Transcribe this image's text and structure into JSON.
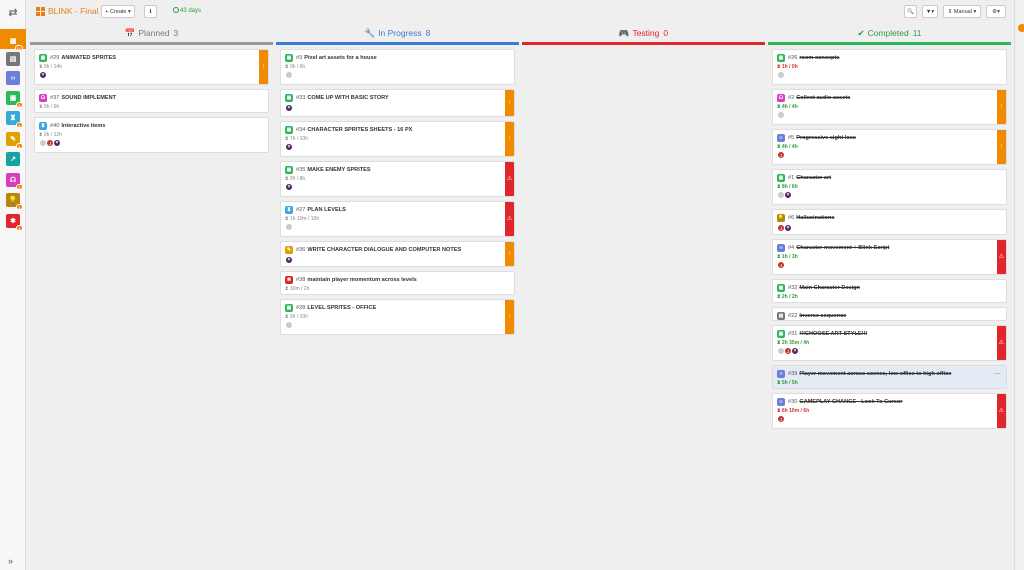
{
  "topbar": {
    "title": "BLINK - Final",
    "create_label": "+ Create ▾",
    "info_label": "ℹ",
    "days": "43 days",
    "search_icon": "🔍",
    "filter_label": "▼▾",
    "sort_label": "⇕ Manual ▾",
    "settings_label": "⚙▾"
  },
  "sidebar": {
    "items": [
      {
        "icon": "board-icon",
        "color": "#f08a00",
        "badge": "11"
      },
      {
        "icon": "general-icon",
        "color": "#777777",
        "badge": ""
      },
      {
        "icon": "code-icon",
        "color": "#6c7fd8",
        "badge": ""
      },
      {
        "icon": "art-icon",
        "color": "#2eb85c",
        "badge": "6"
      },
      {
        "icon": "level-icon",
        "color": "#39a9db",
        "badge": "2"
      },
      {
        "icon": "writing-icon",
        "color": "#e0a000",
        "badge": "1"
      },
      {
        "icon": "chart-icon",
        "color": "#16a2a0",
        "badge": ""
      },
      {
        "icon": "audio-icon",
        "color": "#d63dbb",
        "badge": "1"
      },
      {
        "icon": "idea-icon",
        "color": "#b8860b",
        "badge": "1"
      },
      {
        "icon": "bug-icon",
        "color": "#e0262b",
        "badge": "1"
      }
    ]
  },
  "columns": [
    {
      "name": "Planned",
      "count": "3",
      "icon": "📅",
      "color": "#999999",
      "head_color": "#777777",
      "cards": [
        {
          "num": "#29",
          "title": "ANIMATED SPRITES",
          "cat": "#2eb85c",
          "time": "0h / 14h",
          "tstate": "",
          "avatars": [
            "p"
          ],
          "flag": "orange",
          "done": false,
          "h": 36
        },
        {
          "num": "#37",
          "title": "SOUND IMPLEMENT",
          "cat": "#d63dbb",
          "time": "0h / 6h",
          "tstate": "",
          "avatars": [],
          "flag": "",
          "done": false,
          "h": 24
        },
        {
          "num": "#40",
          "title": "Interactive items",
          "cat": "#39a9db",
          "time": "0h / 12h",
          "tstate": "",
          "avatars": [
            "ghost",
            "j",
            "p"
          ],
          "flag": "",
          "done": false,
          "h": 36
        }
      ]
    },
    {
      "name": "In Progress",
      "count": "8",
      "icon": "🔧",
      "color": "#3a7bd5",
      "head_color": "#3a7bd5",
      "cards": [
        {
          "num": "#3",
          "title": "Pixel art assets for a house",
          "cat": "#2eb85c",
          "time": "0h / 6h",
          "tstate": "",
          "avatars": [
            "ghost"
          ],
          "flag": "",
          "done": false,
          "h": 36
        },
        {
          "num": "#33",
          "title": "COME UP WITH BASIC STORY",
          "cat": "#2eb85c",
          "time": "",
          "tstate": "",
          "avatars": [
            "p"
          ],
          "flag": "orange",
          "done": false,
          "h": 28
        },
        {
          "num": "#34",
          "title": "CHARACTER SPRITES SHEETS - 16 PX",
          "cat": "#2eb85c",
          "time": "7h / 10h",
          "tstate": "",
          "avatars": [
            "p"
          ],
          "flag": "orange",
          "done": false,
          "h": 36
        },
        {
          "num": "#35",
          "title": "MAKE ENEMY SPRITES",
          "cat": "#2eb85c",
          "time": "2h / 8h",
          "tstate": "",
          "avatars": [
            "p"
          ],
          "flag": "red",
          "done": false,
          "h": 36
        },
        {
          "num": "#27",
          "title": "PLAN LEVELS",
          "cat": "#39a9db",
          "time": "1h 10m / 10h",
          "tstate": "",
          "avatars": [
            "ghost"
          ],
          "flag": "red",
          "done": false,
          "h": 36
        },
        {
          "num": "#36",
          "title": "WRITE CHARACTER DIALOGUE AND COMPUTER NOTES",
          "cat": "#e0a000",
          "time": "",
          "tstate": "",
          "avatars": [
            "p"
          ],
          "flag": "orange",
          "done": false,
          "h": 26
        },
        {
          "num": "#38",
          "title": "maintain player momentum across levels",
          "cat": "#e0262b",
          "time": "30m / 2h",
          "tstate": "",
          "avatars": [],
          "flag": "",
          "done": false,
          "h": 24
        },
        {
          "num": "#28",
          "title": "LEVEL SPRITES - OFFICE",
          "cat": "#2eb85c",
          "time": "2h / 10h",
          "tstate": "",
          "avatars": [
            "ghost"
          ],
          "flag": "orange",
          "done": false,
          "h": 36
        }
      ]
    },
    {
      "name": "Testing",
      "count": "0",
      "icon": "🎮",
      "color": "#e0262b",
      "head_color": "#e0262b",
      "cards": []
    },
    {
      "name": "Completed",
      "count": "11",
      "icon": "✔",
      "color": "#2eb85c",
      "head_color": "#2e9c3a",
      "cards": [
        {
          "num": "#26",
          "title": "room concepts",
          "cat": "#2eb85c",
          "time": "1h / 0h",
          "tstate": "red",
          "avatars": [
            "ghost"
          ],
          "flag": "",
          "done": true,
          "h": 36
        },
        {
          "num": "#2",
          "title": "Collect audio assets",
          "cat": "#d63dbb",
          "time": "4h / 4h",
          "tstate": "green",
          "avatars": [
            "ghost"
          ],
          "flag": "orange",
          "done": true,
          "h": 36
        },
        {
          "num": "#5",
          "title": "Progressive sight loss",
          "cat": "#6c7fd8",
          "time": "4h / 4h",
          "tstate": "green",
          "avatars": [
            "j"
          ],
          "flag": "orange",
          "done": true,
          "h": 36
        },
        {
          "num": "#1",
          "title": "Character art",
          "cat": "#2eb85c",
          "time": "8h / 6h",
          "tstate": "green",
          "avatars": [
            "ghost",
            "p"
          ],
          "flag": "",
          "done": true,
          "h": 36
        },
        {
          "num": "#6",
          "title": "Hallucinations",
          "cat": "#b8860b",
          "time": "",
          "tstate": "",
          "avatars": [
            "j",
            "p"
          ],
          "flag": "",
          "done": true,
          "h": 26
        },
        {
          "num": "#4",
          "title": "Character movement + Blink Script",
          "cat": "#6c7fd8",
          "time": "1h / 3h",
          "tstate": "green",
          "avatars": [
            "j"
          ],
          "flag": "red",
          "done": true,
          "h": 36
        },
        {
          "num": "#32",
          "title": "Main Character Design",
          "cat": "#2eb85c",
          "time": "2h / 2h",
          "tstate": "green",
          "avatars": [],
          "flag": "",
          "done": true,
          "h": 24
        },
        {
          "num": "#22",
          "title": "Inverse sequence",
          "cat": "#777777",
          "time": "",
          "tstate": "",
          "avatars": [],
          "flag": "",
          "done": true,
          "h": 14
        },
        {
          "num": "#31",
          "title": "!!!CHOOSE ART STYLE!!!",
          "cat": "#2eb85c",
          "time": "2h 35m / 4h",
          "tstate": "green",
          "avatars": [
            "ghost",
            "j",
            "p"
          ],
          "flag": "red",
          "done": true,
          "h": 36
        },
        {
          "num": "#39",
          "title": "Player movement across scenes, low office to high office",
          "cat": "#6c7fd8",
          "time": "5h / 5h",
          "tstate": "green",
          "avatars": [],
          "flag": "",
          "done": true,
          "h": 24,
          "highlight": true
        },
        {
          "num": "#30",
          "title": "GAMEPLAY CHANGE - Look To Cursor",
          "cat": "#6c7fd8",
          "time": "6h 10m / 6h",
          "tstate": "red",
          "avatars": [
            "j"
          ],
          "flag": "red",
          "done": true,
          "h": 36
        }
      ]
    }
  ]
}
